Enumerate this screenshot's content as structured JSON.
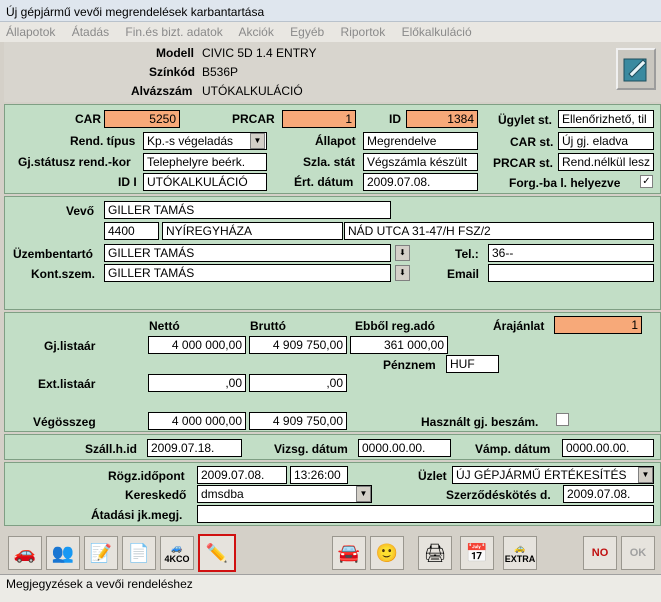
{
  "window": {
    "title": "Új gépjármű vevői megrendelések karbantartása"
  },
  "menu": [
    "Állapotok",
    "Átadás",
    "Fin.és bizt. adatok",
    "Akciók",
    "Egyéb",
    "Riportok",
    "Előkalkuláció"
  ],
  "header": {
    "model_label": "Modell",
    "model_value": "CIVIC 5D 1.4 ENTRY",
    "color_label": "Színkód",
    "color_value": "B536P",
    "chassis_label": "Alvázszám",
    "chassis_value": "UTÓKALKULÁCIÓ"
  },
  "order": {
    "car_label": "CAR",
    "car_value": "5250",
    "prcar_label": "PRCAR",
    "prcar_value": "1",
    "id_label": "ID",
    "id_value": "1384",
    "ugylet_label": "Ügylet st.",
    "ugylet_value": "Ellenőrizhető, til",
    "rend_tipus_label": "Rend. típus",
    "rend_tipus_value": "Kp.-s végeladás",
    "allapot_label": "Állapot",
    "allapot_value": "Megrendelve",
    "car_st_label": "CAR st.",
    "car_st_value": "Új gj. eladva",
    "gj_status_label": "Gj.státusz rend.-kor",
    "gj_status_value": "Telephelyre beérk.",
    "szla_stat_label": "Szla. stát",
    "szla_stat_value": "Végszámla készült",
    "prcar_st_label": "PRCAR st.",
    "prcar_st_value": "Rend.nélkül lesz",
    "id_i_label": "ID I",
    "id_i_value": "UTÓKALKULÁCIÓ",
    "ert_datum_label": "Ért. dátum",
    "ert_datum_value": "2009.07.08.",
    "forg_label": "Forg.-ba l. helyezve",
    "forg_checked": "✓"
  },
  "customer": {
    "vevo_label": "Vevő",
    "vevo_value": "GILLER TAMÁS",
    "zip": "4400",
    "city": "NYÍREGYHÁZA",
    "street": "NÁD UTCA 31-47/H FSZ/2",
    "uzem_label": "Üzembentartó",
    "uzem_value": "GILLER TAMÁS",
    "kont_label": "Kont.szem.",
    "kont_value": "GILLER TAMÁS",
    "tel_label": "Tel.:",
    "tel_value": "36--",
    "email_label": "Email",
    "email_value": ""
  },
  "prices": {
    "netto_label": "Nettó",
    "brutto_label": "Bruttó",
    "reg_label": "Ebből reg.adó",
    "arajanlat_label": "Árajánlat",
    "arajanlat_value": "1",
    "gj_label": "Gj.listaár",
    "gj_netto": "4 000 000,00",
    "gj_brutto": "4 909 750,00",
    "gj_reg": "361 000,00",
    "penznem_label": "Pénznem",
    "penznem_value": "HUF",
    "ext_label": "Ext.listaár",
    "ext_netto": ",00",
    "ext_brutto": ",00",
    "veg_label": "Végösszeg",
    "veg_netto": "4 000 000,00",
    "veg_brutto": "4 909 750,00",
    "hasznalt_label": "Használt gj. beszám."
  },
  "dates": {
    "szall_label": "Száll.h.id",
    "szall_value": "2009.07.18.",
    "vizsg_label": "Vizsg. dátum",
    "vizsg_value": "0000.00.00.",
    "vamp_label": "Vámp. dátum",
    "vamp_value": "0000.00.00."
  },
  "record": {
    "rogz_label": "Rögz.időpont",
    "rogz_date": "2009.07.08.",
    "rogz_time": "13:26:00",
    "uzlet_label": "Üzlet",
    "uzlet_value": "ÚJ GÉPJÁRMŰ ÉRTÉKESÍTÉS",
    "keresk_label": "Kereskedő",
    "keresk_value": "dmsdba",
    "szerz_label": "Szerződéskötés d.",
    "szerz_value": "2009.07.08.",
    "atadasi_label": "Átadási jk.megj.",
    "atadasi_value": ""
  },
  "toolbar": {
    "icons": [
      "car-icon",
      "people-icon",
      "document-sign-icon",
      "vehicle-document-icon",
      "car-4kco-icon",
      "pen-note-icon",
      "cars-icon",
      "face-icon",
      "printer-icon",
      "calendar-icon",
      "car-extra-icon",
      "no-icon",
      "ok-icon"
    ],
    "kco_label": "4KCO",
    "extra_label": "EXTRA",
    "no_label": "NO",
    "ok_label": "OK"
  },
  "status": {
    "text": "Megjegyzések a vevői rendeléshez"
  }
}
